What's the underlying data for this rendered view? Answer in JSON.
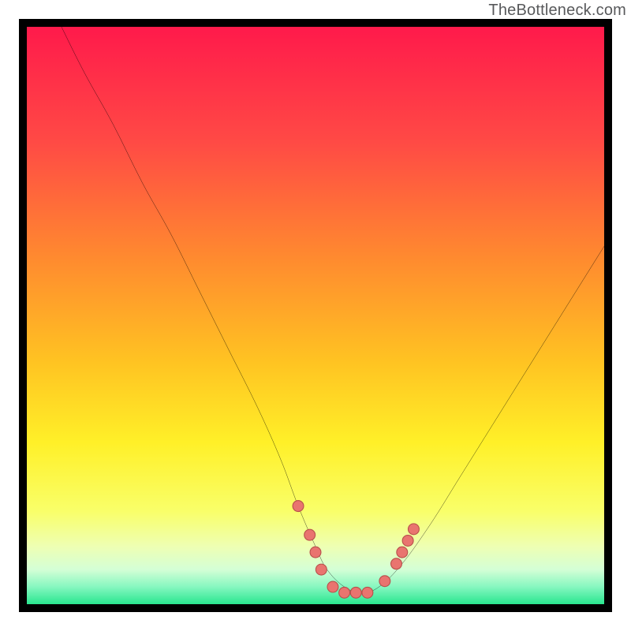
{
  "watermark": {
    "text": "TheBottleneck.com"
  },
  "colors": {
    "frame": "#000000",
    "curve": "#000000",
    "dot_fill": "#e9746f",
    "dot_stroke": "#b84f4b",
    "gradient_stops": [
      {
        "offset": 0.0,
        "color": "#ff1a4b"
      },
      {
        "offset": 0.2,
        "color": "#ff4a45"
      },
      {
        "offset": 0.4,
        "color": "#ff8a2f"
      },
      {
        "offset": 0.58,
        "color": "#ffc322"
      },
      {
        "offset": 0.72,
        "color": "#fff028"
      },
      {
        "offset": 0.84,
        "color": "#f9ff6a"
      },
      {
        "offset": 0.9,
        "color": "#eeffb3"
      },
      {
        "offset": 0.94,
        "color": "#d4ffd6"
      },
      {
        "offset": 0.97,
        "color": "#86f7c0"
      },
      {
        "offset": 1.0,
        "color": "#29e68f"
      }
    ]
  },
  "chart_data": {
    "type": "line",
    "title": "",
    "xlabel": "",
    "ylabel": "",
    "xlim": [
      0,
      100
    ],
    "ylim": [
      0,
      100
    ],
    "series": [
      {
        "name": "bottleneck-curve",
        "x": [
          6,
          10,
          15,
          20,
          25,
          30,
          35,
          40,
          44,
          47,
          50,
          52,
          55,
          58,
          61,
          65,
          70,
          75,
          80,
          85,
          90,
          95,
          100
        ],
        "y": [
          100,
          92,
          83,
          73,
          64,
          54,
          44,
          34,
          25,
          17,
          10,
          6,
          3,
          2,
          3,
          7,
          14,
          22,
          30,
          38,
          46,
          54,
          62
        ]
      }
    ],
    "markers": [
      {
        "x": 47,
        "y": 17
      },
      {
        "x": 49,
        "y": 12
      },
      {
        "x": 50,
        "y": 9
      },
      {
        "x": 51,
        "y": 6
      },
      {
        "x": 53,
        "y": 3
      },
      {
        "x": 55,
        "y": 2
      },
      {
        "x": 57,
        "y": 2
      },
      {
        "x": 59,
        "y": 2
      },
      {
        "x": 62,
        "y": 4
      },
      {
        "x": 64,
        "y": 7
      },
      {
        "x": 65,
        "y": 9
      },
      {
        "x": 66,
        "y": 11
      },
      {
        "x": 67,
        "y": 13
      }
    ]
  }
}
